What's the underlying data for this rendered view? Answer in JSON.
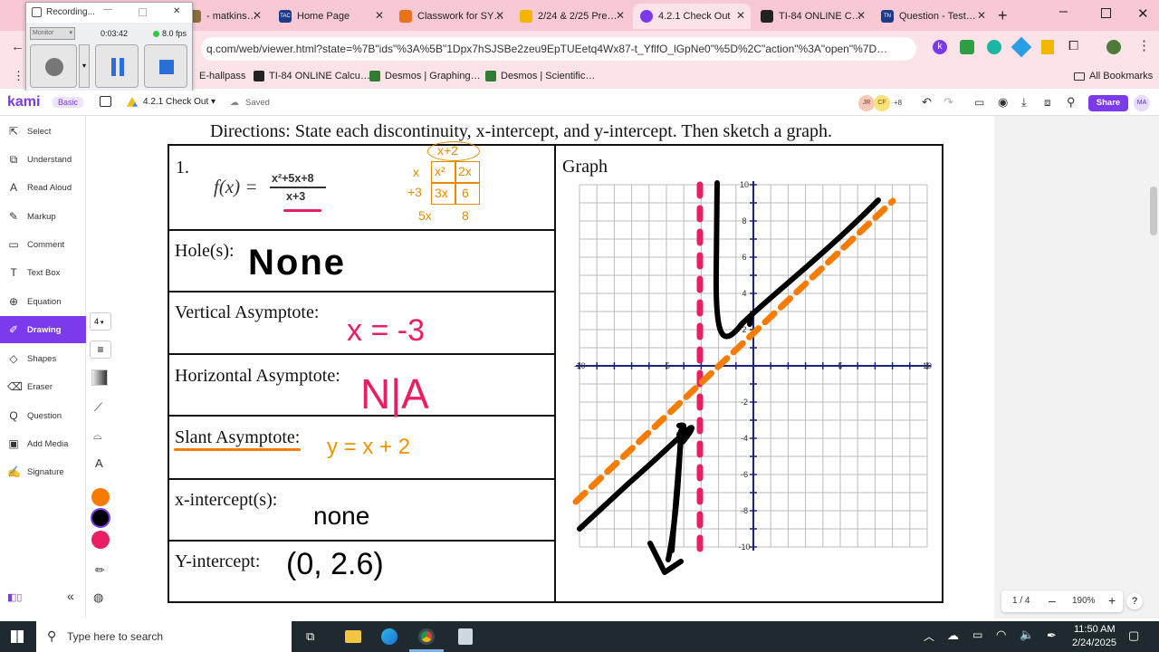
{
  "recorder": {
    "title": "Recording...",
    "source": "Monitor",
    "elapsed": "0:03:42",
    "fps": "8.0 fps"
  },
  "tabs": [
    {
      "label": "- matkins…",
      "color": "#8a6d3b"
    },
    {
      "label": "Home Page",
      "color": "#1e3a8a",
      "fav_text": "TAC"
    },
    {
      "label": "Classwork for SY…",
      "color": "#e8731a"
    },
    {
      "label": "2/24 & 2/25 Pre…",
      "color": "#f4b400"
    },
    {
      "label": "4.2.1 Check Out",
      "color": "#7c3aed"
    },
    {
      "label": "TI-84 ONLINE C…",
      "color": "#222222"
    },
    {
      "label": "Question - Test…",
      "color": "#1e3a8a",
      "fav_text": "TN"
    }
  ],
  "url": "q.com/web/viewer.html?state=%7B\"ids\"%3A%5B\"1Dpx7hSJSBe2zeu9EpTUEetq4Wx87-t_YflfO_lGpNe0\"%5D%2C\"action\"%3A\"open\"%7D…",
  "bookmarks": [
    {
      "label": "E-hallpass"
    },
    {
      "label": "TI-84 ONLINE Calcu…"
    },
    {
      "label": "Desmos | Graphing…"
    },
    {
      "label": "Desmos | Scientific…"
    }
  ],
  "all_bookmarks": "All Bookmarks",
  "kami": {
    "logo": "kami",
    "plan": "Basic",
    "doc_title": "4.2.1 Check Out",
    "saved": "Saved",
    "avatars": [
      "JR",
      "CF"
    ],
    "avatars_more": "+8",
    "share": "Share",
    "user": "MA"
  },
  "sidebar": [
    {
      "label": "Select",
      "icon": "cursor-icon"
    },
    {
      "label": "Understand",
      "icon": "dictionary-icon"
    },
    {
      "label": "Read Aloud",
      "icon": "speaker-icon"
    },
    {
      "label": "Markup",
      "icon": "highlighter-icon"
    },
    {
      "label": "Comment",
      "icon": "comment-icon"
    },
    {
      "label": "Text Box",
      "icon": "text-icon"
    },
    {
      "label": "Equation",
      "icon": "equation-icon"
    },
    {
      "label": "Drawing",
      "icon": "pen-icon"
    },
    {
      "label": "Shapes",
      "icon": "shapes-icon"
    },
    {
      "label": "Eraser",
      "icon": "eraser-icon"
    },
    {
      "label": "Question",
      "icon": "question-icon"
    },
    {
      "label": "Add Media",
      "icon": "media-icon"
    },
    {
      "label": "Signature",
      "icon": "signature-icon"
    }
  ],
  "drawing_tools": {
    "size": "4",
    "colors": [
      "#f57c00",
      "#000000",
      "#e91e63"
    ]
  },
  "document": {
    "directions": "Directions: State each discontinuity, x-intercept, and y-intercept. Then sketch a graph.",
    "problem_number": "1.",
    "function_lhs": "f(x) =",
    "numerator": "x²+5x+8",
    "denominator": "x+3",
    "graph_label": "Graph",
    "rows": [
      {
        "label": "Hole(s):",
        "answer": "None"
      },
      {
        "label": "Vertical Asymptote:",
        "answer": "x = -3"
      },
      {
        "label": "Horizontal Asymptote:",
        "answer": "N|A"
      },
      {
        "label": "Slant Asymptote:",
        "answer": "y = x + 2"
      },
      {
        "label": "x-intercept(s):",
        "answer": "none"
      },
      {
        "label": "Y-intercept:",
        "answer": "(0, 2.6)"
      }
    ],
    "division_work": {
      "top": "x+2",
      "left": [
        "x",
        "+3"
      ],
      "cells": [
        "x²",
        "2x",
        "3x",
        "6"
      ],
      "bottom": [
        "5x",
        "8"
      ]
    }
  },
  "graph": {
    "x_ticks": [
      "-10",
      "-5",
      "5",
      "10"
    ],
    "y_ticks": [
      "10",
      "8",
      "6",
      "4",
      "2",
      "-2",
      "-4",
      "-6",
      "-8",
      "-10"
    ]
  },
  "page_nav": {
    "page": "1 / 4",
    "zoom": "190%"
  },
  "taskbar": {
    "search": "Type here to search",
    "time": "11:50 AM",
    "date": "2/24/2025"
  }
}
